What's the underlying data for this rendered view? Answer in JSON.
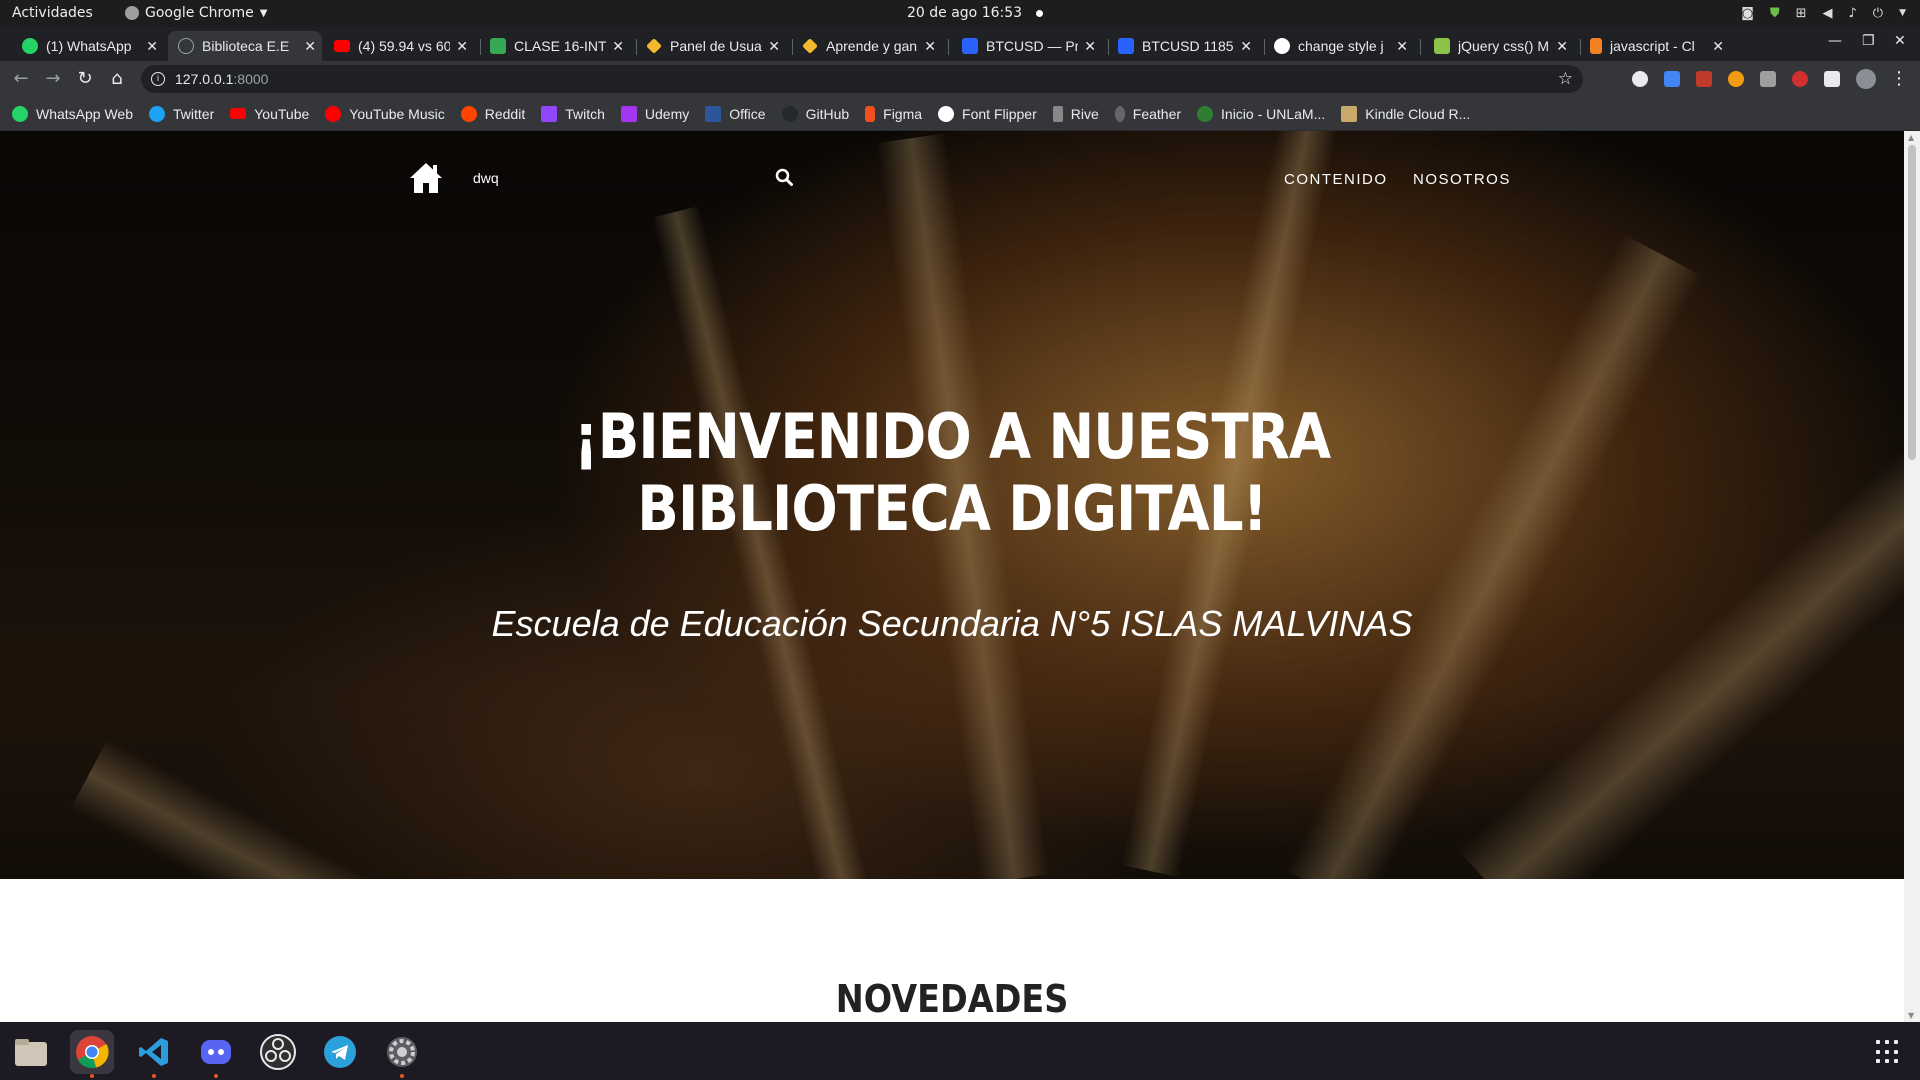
{
  "system": {
    "activities": "Actividades",
    "app_name": "Google Chrome",
    "clock": "20 de ago  16:53"
  },
  "tabs": [
    {
      "title": "(1) WhatsApp",
      "color": "#25d366",
      "active": false
    },
    {
      "title": "Biblioteca E.E",
      "color": "#9aa0a6",
      "active": true
    },
    {
      "title": "(4) 59.94 vs 60",
      "color": "#ff0000",
      "active": false
    },
    {
      "title": "CLASE 16-INTE",
      "color": "#34a853",
      "active": false
    },
    {
      "title": "Panel de Usua",
      "color": "#f3ba2f",
      "active": false
    },
    {
      "title": "Aprende y gan",
      "color": "#f3ba2f",
      "active": false
    },
    {
      "title": "BTCUSD — Pr",
      "color": "#2962ff",
      "active": false
    },
    {
      "title": "BTCUSD 1185",
      "color": "#2962ff",
      "active": false
    },
    {
      "title": "change style j",
      "color": "#4285f4",
      "active": false
    },
    {
      "title": "jQuery css() M",
      "color": "#8bc34a",
      "active": false
    },
    {
      "title": "javascript - Cl",
      "color": "#f48024",
      "active": false
    }
  ],
  "address_bar": {
    "host": "127.0.0.1",
    "port": ":8000"
  },
  "bookmarks": [
    {
      "label": "WhatsApp Web",
      "color": "#25d366"
    },
    {
      "label": "Twitter",
      "color": "#1da1f2"
    },
    {
      "label": "YouTube",
      "color": "#ff0000"
    },
    {
      "label": "YouTube Music",
      "color": "#ff0000"
    },
    {
      "label": "Reddit",
      "color": "#ff4500"
    },
    {
      "label": "Twitch",
      "color": "#9146ff"
    },
    {
      "label": "Udemy",
      "color": "#a435f0"
    },
    {
      "label": "Office",
      "color": "#2b579a"
    },
    {
      "label": "GitHub",
      "color": "#24292e"
    },
    {
      "label": "Figma",
      "color": "#f24e1e"
    },
    {
      "label": "Font Flipper",
      "color": "#ffffff"
    },
    {
      "label": "Rive",
      "color": "#888888"
    },
    {
      "label": "Feather",
      "color": "#666666"
    },
    {
      "label": "Inicio - UNLaM...",
      "color": "#2e7d32"
    },
    {
      "label": "Kindle Cloud R...",
      "color": "#c8a86b"
    }
  ],
  "site": {
    "search_value": "dwq",
    "nav": [
      "CONTENIDO",
      "NOSOTROS"
    ],
    "hero_title_line1": "¡BIENVENIDO A NUESTRA",
    "hero_title_line2": "BIBLIOTECA DIGITAL!",
    "hero_subtitle": "Escuela de Educación Secundaria N°5 ISLAS MALVINAS",
    "section_title": "NOVEDADES"
  },
  "dock": [
    "files-icon",
    "chrome-icon",
    "vscode-icon",
    "discord-icon",
    "obs-icon",
    "telegram-icon",
    "settings-icon"
  ]
}
